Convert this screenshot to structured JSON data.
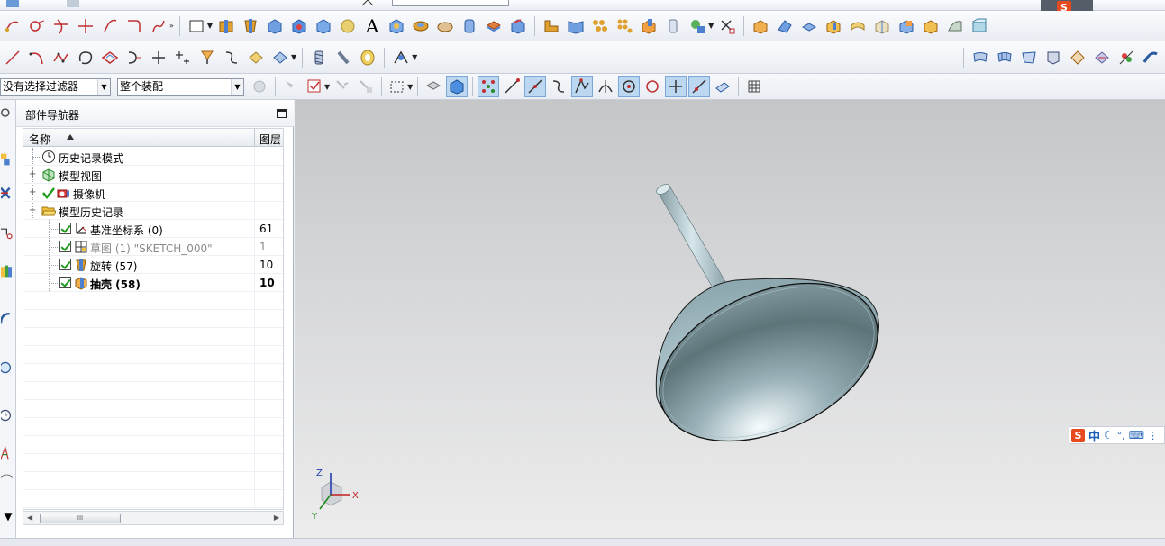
{
  "filter_bar": {
    "selection_filter": "没有选择过滤器",
    "assembly_scope": "整个装配"
  },
  "part_navigator": {
    "title": "部件导航器",
    "columns": {
      "name": "名称",
      "layer": "图层"
    },
    "rows": [
      {
        "label": "历史记录模式",
        "layer": ""
      },
      {
        "label": "模型视图",
        "layer": ""
      },
      {
        "label": "摄像机",
        "layer": ""
      },
      {
        "label": "模型历史记录",
        "layer": ""
      },
      {
        "label": "基准坐标系 (0)",
        "layer": "61"
      },
      {
        "label": "草图 (1) \"SKETCH_000\"",
        "layer": "1"
      },
      {
        "label": "旋转 (57)",
        "layer": "10"
      },
      {
        "label": "抽壳 (58)",
        "layer": "10"
      }
    ],
    "scroll_thumb": "III"
  },
  "toolbar": {
    "text_tool": "A"
  },
  "triad": {
    "x": "X",
    "y": "Y",
    "z": "Z"
  },
  "ime": {
    "logo": "S",
    "mode": "中"
  },
  "colors": {
    "accent_blue": "#2a6fd0",
    "check_green": "#1d9b1d",
    "part_color": "#a9c4cc"
  }
}
